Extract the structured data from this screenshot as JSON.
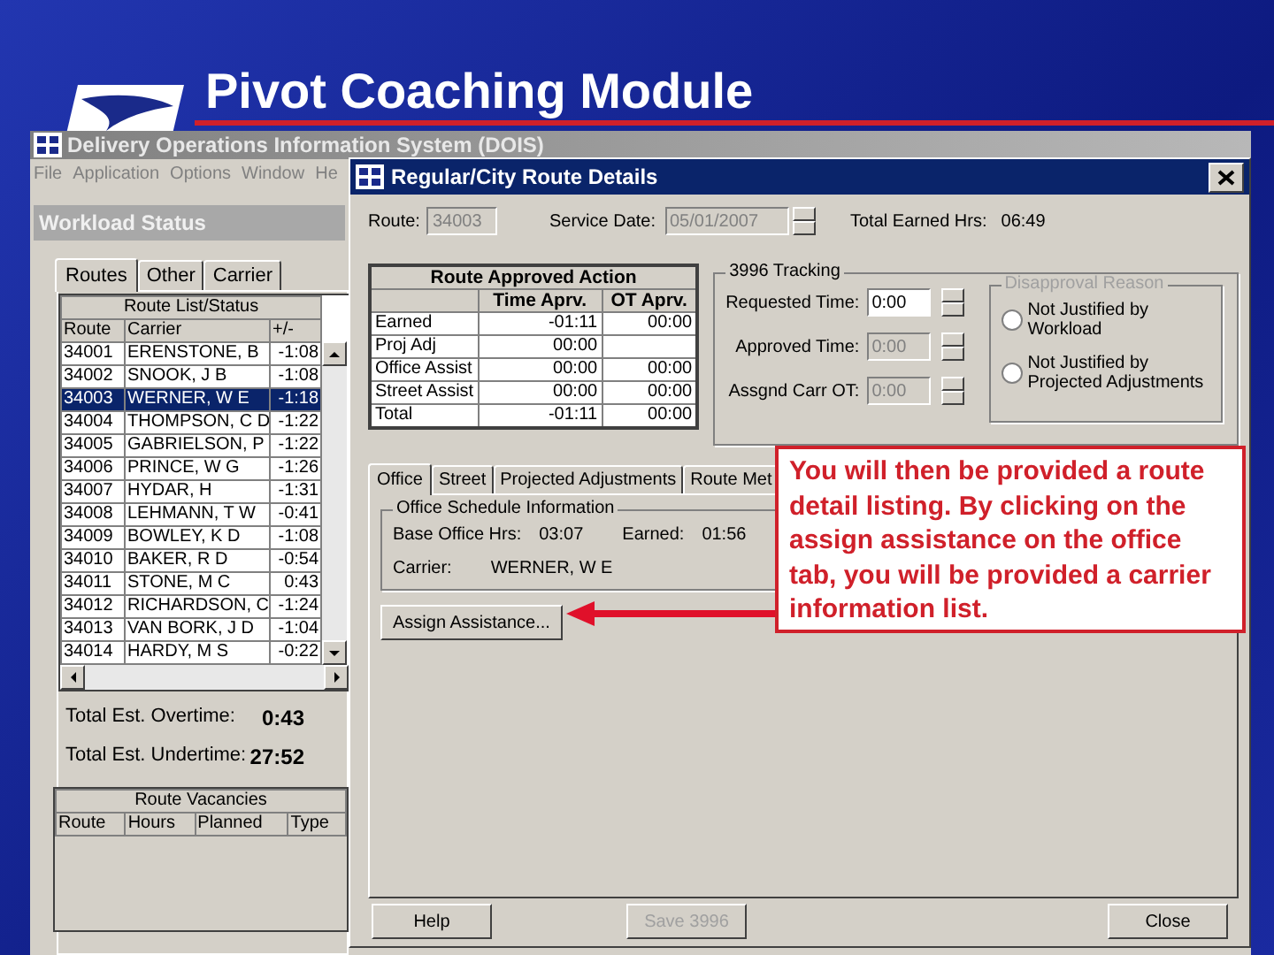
{
  "slide": {
    "title": "Pivot Coaching Module"
  },
  "main_window": {
    "title": "Delivery Operations Information System (DOIS)",
    "menu": [
      "File",
      "Application",
      "Options",
      "Window",
      "He"
    ],
    "panel_title": "Workload Status",
    "tabs": [
      {
        "label": "Routes",
        "selected": true
      },
      {
        "label": "Other",
        "selected": false
      },
      {
        "label": "Carrier",
        "selected": false
      }
    ],
    "route_list": {
      "title": "Route List/Status",
      "columns": [
        "Route",
        "Carrier",
        "+/-"
      ],
      "rows": [
        {
          "route": "34001",
          "carrier": "ERENSTONE, B",
          "delta": "-1:08",
          "selected": false
        },
        {
          "route": "34002",
          "carrier": "SNOOK, J B",
          "delta": "-1:08",
          "selected": false
        },
        {
          "route": "34003",
          "carrier": "WERNER, W E",
          "delta": "-1:18",
          "selected": true
        },
        {
          "route": "34004",
          "carrier": "THOMPSON, C D",
          "delta": "-1:22",
          "selected": false
        },
        {
          "route": "34005",
          "carrier": "GABRIELSON, P",
          "delta": "-1:22",
          "selected": false
        },
        {
          "route": "34006",
          "carrier": "PRINCE, W G",
          "delta": "-1:26",
          "selected": false
        },
        {
          "route": "34007",
          "carrier": "HYDAR, H",
          "delta": "-1:31",
          "selected": false
        },
        {
          "route": "34008",
          "carrier": "LEHMANN, T W",
          "delta": "-0:41",
          "selected": false
        },
        {
          "route": "34009",
          "carrier": "BOWLEY, K D",
          "delta": "-1:08",
          "selected": false
        },
        {
          "route": "34010",
          "carrier": "BAKER, R D",
          "delta": "-0:54",
          "selected": false
        },
        {
          "route": "34011",
          "carrier": "STONE, M C",
          "delta": "0:43",
          "selected": false
        },
        {
          "route": "34012",
          "carrier": "RICHARDSON, C",
          "delta": "-1:24",
          "selected": false
        },
        {
          "route": "34013",
          "carrier": "VAN BORK, J D",
          "delta": "-1:04",
          "selected": false
        },
        {
          "route": "34014",
          "carrier": "HARDY, M S",
          "delta": "-0:22",
          "selected": false
        }
      ]
    },
    "totals": [
      {
        "label": "Total Est. Overtime:",
        "value": "0:43"
      },
      {
        "label": "Total Est. Undertime:",
        "value": "27:52"
      }
    ],
    "vacancies": {
      "title": "Route Vacancies",
      "columns": [
        "Route",
        "Hours",
        "Planned",
        "Type"
      ]
    }
  },
  "dialog": {
    "title": "Regular/City Route Details",
    "route": {
      "label": "Route:",
      "value": "34003"
    },
    "service_date": {
      "label": "Service Date:",
      "value": "05/01/2007"
    },
    "total_earned": {
      "label": "Total Earned Hrs:",
      "value": "06:49"
    },
    "approved_action": {
      "title": "Route Approved Action",
      "columns": [
        "Time Aprv.",
        "OT Aprv."
      ],
      "rows": [
        {
          "label": "Earned",
          "time": "-01:11",
          "ot": "00:00"
        },
        {
          "label": "Proj Adj",
          "time": "00:00"
        },
        {
          "label": "Office Assist",
          "time": "00:00",
          "ot": "00:00"
        },
        {
          "label": "Street Assist",
          "time": "00:00",
          "ot": "00:00"
        },
        {
          "label": "Total",
          "time": "-01:11",
          "ot": "00:00"
        }
      ]
    },
    "tracking": {
      "title": "3996 Tracking",
      "fields": [
        {
          "label": "Requested Time:",
          "value": "0:00",
          "disabled": false
        },
        {
          "label": "Approved Time:",
          "value": "0:00",
          "disabled": true
        },
        {
          "label": "Assgnd Carr OT:",
          "value": "0:00",
          "disabled": true
        }
      ]
    },
    "disapproval": {
      "title": "Disapproval Reason",
      "disabled": true,
      "options": [
        {
          "label": "Not Justified by Workload",
          "selected": false
        },
        {
          "label": "Not Justified by Projected Adjustments",
          "selected": false
        }
      ]
    },
    "tabs": [
      {
        "label": "Office",
        "selected": true
      },
      {
        "label": "Street",
        "selected": false
      },
      {
        "label": "Projected Adjustments",
        "selected": false
      },
      {
        "label": "Route Met",
        "selected": false
      }
    ],
    "office_schedule": {
      "title": "Office Schedule Information",
      "base_office": {
        "label": "Base Office Hrs:",
        "value": "03:07"
      },
      "earned": {
        "label": "Earned:",
        "value": "01:56"
      },
      "carrier": {
        "label": "Carrier:",
        "value": "WERNER, W E"
      }
    },
    "assign_button": "Assign Assistance...",
    "buttons": [
      {
        "label": "Help",
        "disabled": false
      },
      {
        "label": "Save 3996",
        "disabled": true
      },
      {
        "label": "Close",
        "disabled": false
      }
    ]
  },
  "callout": {
    "text": "You will then be provided a route detail listing. By clicking on the assign assistance on the office tab, you will be provided a carrier information list."
  }
}
